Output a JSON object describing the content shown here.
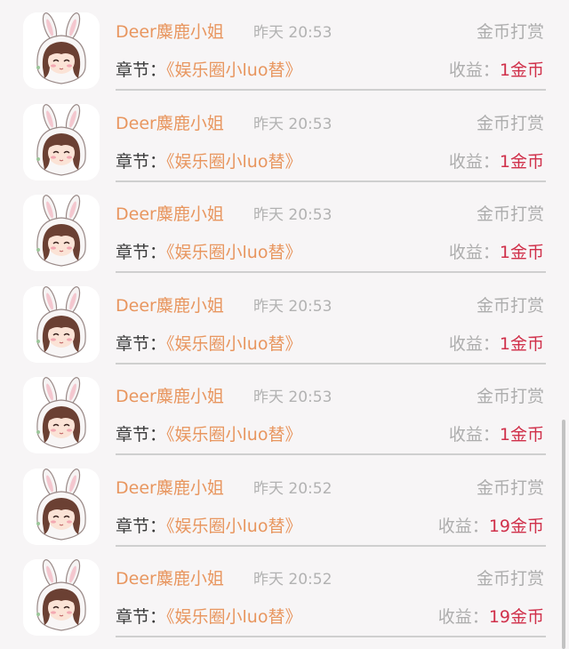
{
  "colors": {
    "background": "#f7f5f6",
    "name": "#e8965f",
    "time": "#b2b2b2",
    "type": "#adadad",
    "chapter_label": "#3a3a3a",
    "chapter_title": "#e8965f",
    "income_value": "#d0304a",
    "divider": "#cfcfcf"
  },
  "records": [
    {
      "avatar_icon": "bunny-hood-girl-avatar",
      "name": "Deer麋鹿小姐",
      "time": "昨天 20:53",
      "type": "金币打赏",
      "chapter_label": "章节：",
      "chapter_title": "《娱乐圈小luo替》",
      "income_label": "收益：",
      "income_value": "1金币"
    },
    {
      "avatar_icon": "bunny-hood-girl-avatar",
      "name": "Deer麋鹿小姐",
      "time": "昨天 20:53",
      "type": "金币打赏",
      "chapter_label": "章节：",
      "chapter_title": "《娱乐圈小luo替》",
      "income_label": "收益：",
      "income_value": "1金币"
    },
    {
      "avatar_icon": "bunny-hood-girl-avatar",
      "name": "Deer麋鹿小姐",
      "time": "昨天 20:53",
      "type": "金币打赏",
      "chapter_label": "章节：",
      "chapter_title": "《娱乐圈小luo替》",
      "income_label": "收益：",
      "income_value": "1金币"
    },
    {
      "avatar_icon": "bunny-hood-girl-avatar",
      "name": "Deer麋鹿小姐",
      "time": "昨天 20:53",
      "type": "金币打赏",
      "chapter_label": "章节：",
      "chapter_title": "《娱乐圈小luo替》",
      "income_label": "收益：",
      "income_value": "1金币"
    },
    {
      "avatar_icon": "bunny-hood-girl-avatar",
      "name": "Deer麋鹿小姐",
      "time": "昨天 20:53",
      "type": "金币打赏",
      "chapter_label": "章节：",
      "chapter_title": "《娱乐圈小luo替》",
      "income_label": "收益：",
      "income_value": "1金币"
    },
    {
      "avatar_icon": "bunny-hood-girl-avatar",
      "name": "Deer麋鹿小姐",
      "time": "昨天 20:52",
      "type": "金币打赏",
      "chapter_label": "章节：",
      "chapter_title": "《娱乐圈小luo替》",
      "income_label": "收益：",
      "income_value": "19金币"
    },
    {
      "avatar_icon": "bunny-hood-girl-avatar",
      "name": "Deer麋鹿小姐",
      "time": "昨天 20:52",
      "type": "金币打赏",
      "chapter_label": "章节：",
      "chapter_title": "《娱乐圈小luo替》",
      "income_label": "收益：",
      "income_value": "19金币"
    }
  ]
}
